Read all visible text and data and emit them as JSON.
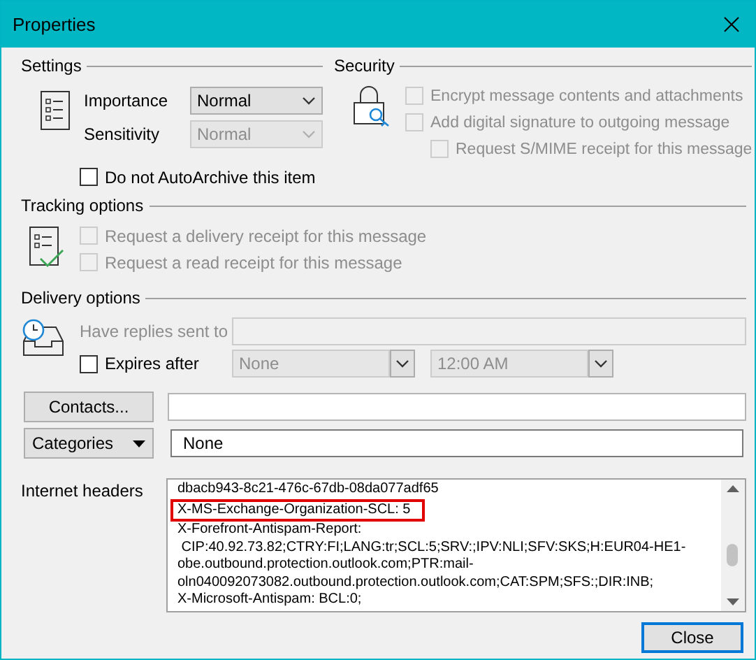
{
  "window": {
    "title": "Properties"
  },
  "settings": {
    "title": "Settings",
    "fields": [
      {
        "label": "Importance",
        "value": "Normal",
        "disabled": false
      },
      {
        "label": "Sensitivity",
        "value": "Normal",
        "disabled": true
      }
    ],
    "auto_archive": {
      "label": "Do not AutoArchive this item",
      "checked": false
    }
  },
  "security": {
    "title": "Security",
    "options": [
      {
        "label": "Encrypt message contents and attachments",
        "checked": false,
        "disabled": true,
        "indented": false
      },
      {
        "label": "Add digital signature to outgoing message",
        "checked": false,
        "disabled": true,
        "indented": false
      },
      {
        "label": "Request S/MIME receipt for this message",
        "checked": false,
        "disabled": true,
        "indented": true
      }
    ]
  },
  "tracking": {
    "title": "Tracking options",
    "options": [
      {
        "label": "Request a delivery receipt for this message",
        "checked": false,
        "disabled": true
      },
      {
        "label": "Request a read receipt for this message",
        "checked": false,
        "disabled": true
      }
    ]
  },
  "delivery": {
    "title": "Delivery options",
    "replies": {
      "label": "Have replies sent to",
      "disabled": true
    },
    "expires": {
      "label": "Expires after",
      "checked": false,
      "date": "None",
      "time": "12:00 AM"
    }
  },
  "contacts": {
    "label": "Contacts..."
  },
  "categories": {
    "label": "Categories",
    "value": "None"
  },
  "headers": {
    "label": "Internet headers",
    "lines": [
      {
        "text": "dbacb943-8c21-476c-67db-08da077adf65",
        "highlighted": false
      },
      {
        "text": "X-MS-Exchange-Organization-SCL: 5",
        "highlighted": true
      },
      {
        "text": "X-Forefront-Antispam-Report:",
        "highlighted": false
      },
      {
        "text": " CIP:40.92.73.82;CTRY:FI;LANG:tr;SCL:5;SRV:;IPV:NLI;SFV:SKS;H:EUR04-HE1-",
        "highlighted": false
      },
      {
        "text": "obe.outbound.protection.outlook.com;PTR:mail-",
        "highlighted": false
      },
      {
        "text": "oln040092073082.outbound.protection.outlook.com;CAT:SPM;SFS:;DIR:INB;",
        "highlighted": false
      },
      {
        "text": "X-Microsoft-Antispam: BCL:0;",
        "highlighted": false
      }
    ]
  },
  "close_button": "Close"
}
